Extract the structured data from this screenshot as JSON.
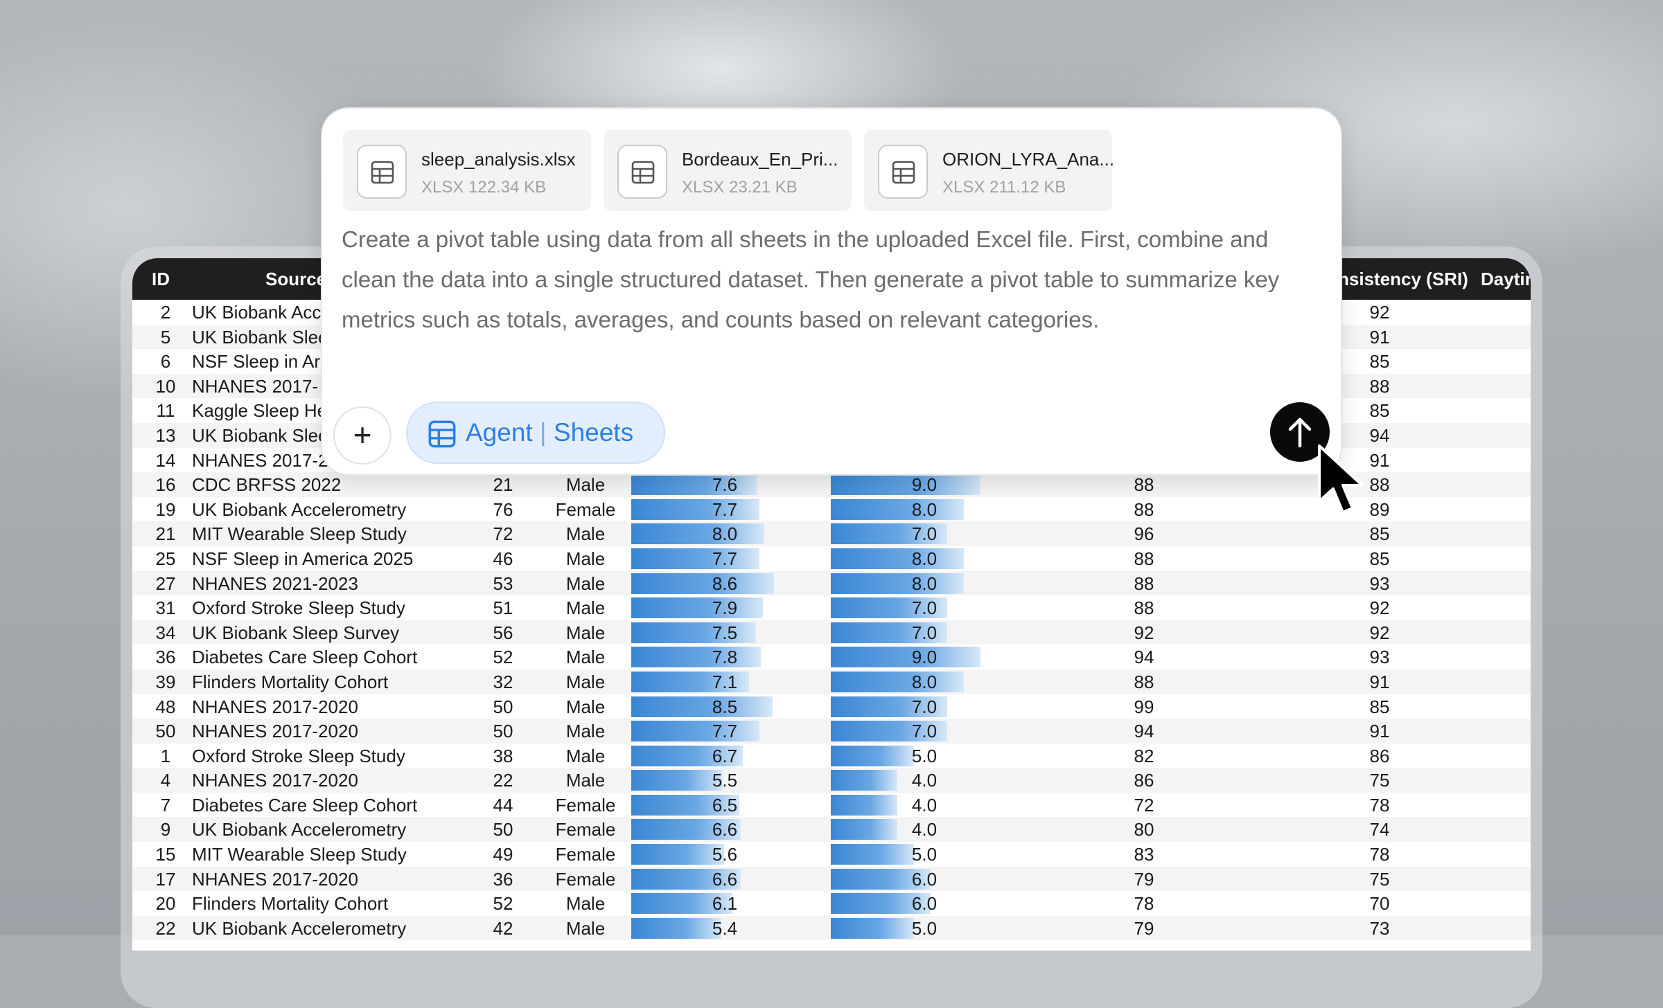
{
  "files": [
    {
      "name": "sleep_analysis.xlsx",
      "meta": "XLSX 122.34 KB"
    },
    {
      "name": "Bordeaux_En_Pri...",
      "meta": "XLSX 23.21 KB"
    },
    {
      "name": "ORION_LYRA_Ana...",
      "meta": "XLSX 211.12 KB"
    }
  ],
  "prompt": "Create a pivot table using data from all sheets in the uploaded Excel file. First, combine and clean the data into a single structured dataset. Then generate a pivot table to summarize key metrics such as totals, averages, and counts based on relevant categories.",
  "composer": {
    "plus_label": "+",
    "agent_label": "Agent",
    "agent_sep": "|",
    "sheets_label": "Sheets",
    "icons": {
      "file": "spreadsheet-icon",
      "send": "arrow-up-icon",
      "cursor": "mouse-pointer-icon"
    }
  },
  "table": {
    "headers": {
      "id": "ID",
      "source": "Source",
      "sri": "nsistency (SRI)",
      "daytime": "Daytir"
    },
    "bar_scale_max_1": 10,
    "bar_scale_max_2": 10,
    "rows": [
      {
        "id": "2",
        "source": "UK Biobank Acc",
        "age": "",
        "sex": "",
        "v1": null,
        "v2": null,
        "m3": "",
        "sri": "92"
      },
      {
        "id": "5",
        "source": "UK Biobank Slee",
        "age": "",
        "sex": "",
        "v1": null,
        "v2": null,
        "m3": "",
        "sri": "91"
      },
      {
        "id": "6",
        "source": "NSF Sleep in Ar",
        "age": "",
        "sex": "",
        "v1": null,
        "v2": null,
        "m3": "",
        "sri": "85"
      },
      {
        "id": "10",
        "source": "NHANES 2017-",
        "age": "",
        "sex": "",
        "v1": null,
        "v2": null,
        "m3": "",
        "sri": "88"
      },
      {
        "id": "11",
        "source": "Kaggle Sleep He",
        "age": "",
        "sex": "",
        "v1": null,
        "v2": null,
        "m3": "",
        "sri": "85"
      },
      {
        "id": "13",
        "source": "UK Biobank Slee",
        "age": "",
        "sex": "",
        "v1": null,
        "v2": null,
        "m3": "",
        "sri": "94"
      },
      {
        "id": "14",
        "source": "NHANES 2017-2",
        "age": "",
        "sex": "",
        "v1": null,
        "v2": null,
        "m3": "",
        "sri": "91"
      },
      {
        "id": "16",
        "source": "CDC BRFSS 2022",
        "age": "21",
        "sex": "Male",
        "v1": "7.6",
        "v2": "9.0",
        "m3": "88",
        "sri": "88"
      },
      {
        "id": "19",
        "source": "UK Biobank Accelerometry",
        "age": "76",
        "sex": "Female",
        "v1": "7.7",
        "v2": "8.0",
        "m3": "88",
        "sri": "89"
      },
      {
        "id": "21",
        "source": "MIT Wearable Sleep Study",
        "age": "72",
        "sex": "Male",
        "v1": "8.0",
        "v2": "7.0",
        "m3": "96",
        "sri": "85"
      },
      {
        "id": "25",
        "source": "NSF Sleep in America 2025",
        "age": "46",
        "sex": "Male",
        "v1": "7.7",
        "v2": "8.0",
        "m3": "88",
        "sri": "85"
      },
      {
        "id": "27",
        "source": "NHANES 2021-2023",
        "age": "53",
        "sex": "Male",
        "v1": "8.6",
        "v2": "8.0",
        "m3": "88",
        "sri": "93"
      },
      {
        "id": "31",
        "source": "Oxford Stroke Sleep Study",
        "age": "51",
        "sex": "Male",
        "v1": "7.9",
        "v2": "7.0",
        "m3": "88",
        "sri": "92"
      },
      {
        "id": "34",
        "source": "UK Biobank Sleep Survey",
        "age": "56",
        "sex": "Male",
        "v1": "7.5",
        "v2": "7.0",
        "m3": "92",
        "sri": "92"
      },
      {
        "id": "36",
        "source": "Diabetes Care Sleep Cohort",
        "age": "52",
        "sex": "Male",
        "v1": "7.8",
        "v2": "9.0",
        "m3": "94",
        "sri": "93"
      },
      {
        "id": "39",
        "source": "Flinders Mortality Cohort",
        "age": "32",
        "sex": "Male",
        "v1": "7.1",
        "v2": "8.0",
        "m3": "88",
        "sri": "91"
      },
      {
        "id": "48",
        "source": "NHANES 2017-2020",
        "age": "50",
        "sex": "Male",
        "v1": "8.5",
        "v2": "7.0",
        "m3": "99",
        "sri": "85"
      },
      {
        "id": "50",
        "source": "NHANES 2017-2020",
        "age": "50",
        "sex": "Male",
        "v1": "7.7",
        "v2": "7.0",
        "m3": "94",
        "sri": "91"
      },
      {
        "id": "1",
        "source": "Oxford Stroke Sleep Study",
        "age": "38",
        "sex": "Male",
        "v1": "6.7",
        "v2": "5.0",
        "m3": "82",
        "sri": "86"
      },
      {
        "id": "4",
        "source": "NHANES 2017-2020",
        "age": "22",
        "sex": "Male",
        "v1": "5.5",
        "v2": "4.0",
        "m3": "86",
        "sri": "75"
      },
      {
        "id": "7",
        "source": "Diabetes Care Sleep Cohort",
        "age": "44",
        "sex": "Female",
        "v1": "6.5",
        "v2": "4.0",
        "m3": "72",
        "sri": "78"
      },
      {
        "id": "9",
        "source": "UK Biobank Accelerometry",
        "age": "50",
        "sex": "Female",
        "v1": "6.6",
        "v2": "4.0",
        "m3": "80",
        "sri": "74"
      },
      {
        "id": "15",
        "source": "MIT Wearable Sleep Study",
        "age": "49",
        "sex": "Female",
        "v1": "5.6",
        "v2": "5.0",
        "m3": "83",
        "sri": "78"
      },
      {
        "id": "17",
        "source": "NHANES 2017-2020",
        "age": "36",
        "sex": "Female",
        "v1": "6.6",
        "v2": "6.0",
        "m3": "79",
        "sri": "75"
      },
      {
        "id": "20",
        "source": "Flinders Mortality Cohort",
        "age": "52",
        "sex": "Male",
        "v1": "6.1",
        "v2": "6.0",
        "m3": "78",
        "sri": "70"
      },
      {
        "id": "22",
        "source": "UK Biobank Accelerometry",
        "age": "42",
        "sex": "Male",
        "v1": "5.4",
        "v2": "5.0",
        "m3": "79",
        "sri": "73"
      }
    ]
  }
}
